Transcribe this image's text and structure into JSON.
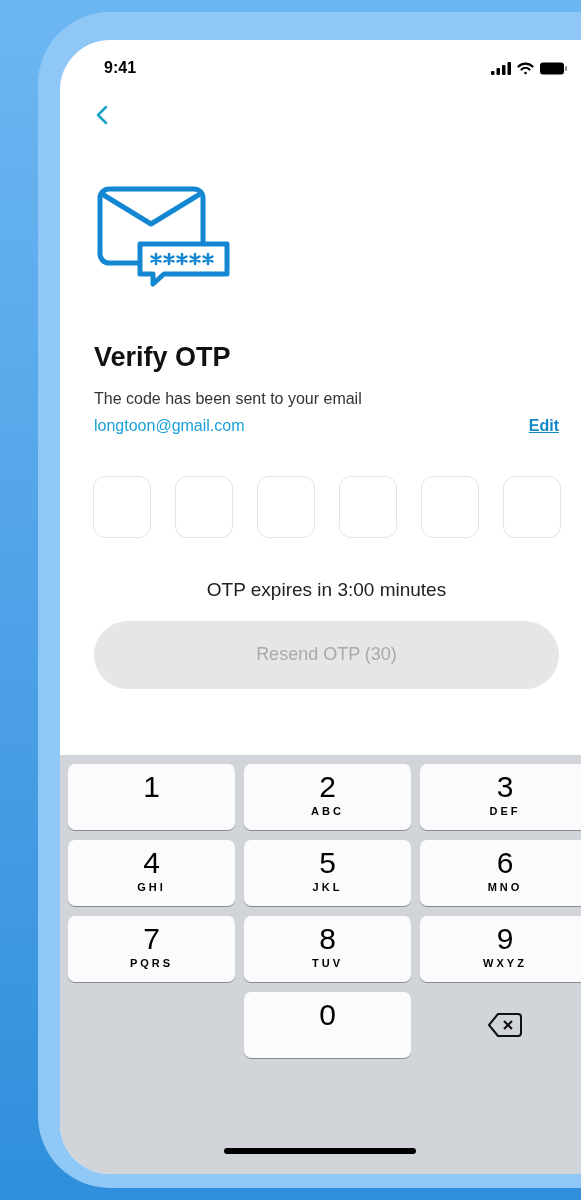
{
  "status_bar": {
    "time": "9:41"
  },
  "screen": {
    "title": "Verify OTP",
    "subtitle": "The code has been sent to your email",
    "email": "longtoon@gmail.com",
    "edit_link": "Edit"
  },
  "otp_fields": [
    {
      "filled": false
    },
    {
      "filled": false
    },
    {
      "filled": false
    },
    {
      "filled": false
    },
    {
      "filled": false
    },
    {
      "filled": false
    }
  ],
  "expiry_text": "OTP expires in 3:00 minutes",
  "resend_button": {
    "label": "Resend OTP (30)",
    "disabled": true
  },
  "keypad": [
    {
      "kind": "digit",
      "digit": "1"
    },
    {
      "kind": "digit",
      "digit": "2",
      "letters": "ABC"
    },
    {
      "kind": "digit",
      "digit": "3",
      "letters": "DEF"
    },
    {
      "kind": "digit",
      "digit": "4",
      "letters": "GHI"
    },
    {
      "kind": "digit",
      "digit": "5",
      "letters": "JKL"
    },
    {
      "kind": "digit",
      "digit": "6",
      "letters": "MNO"
    },
    {
      "kind": "digit",
      "digit": "7",
      "letters": "PQRS"
    },
    {
      "kind": "digit",
      "digit": "8",
      "letters": "TUV"
    },
    {
      "kind": "digit",
      "digit": "9",
      "letters": "WXYZ"
    },
    {
      "kind": "blank"
    },
    {
      "kind": "digit",
      "digit": "0"
    },
    {
      "kind": "delete"
    }
  ]
}
